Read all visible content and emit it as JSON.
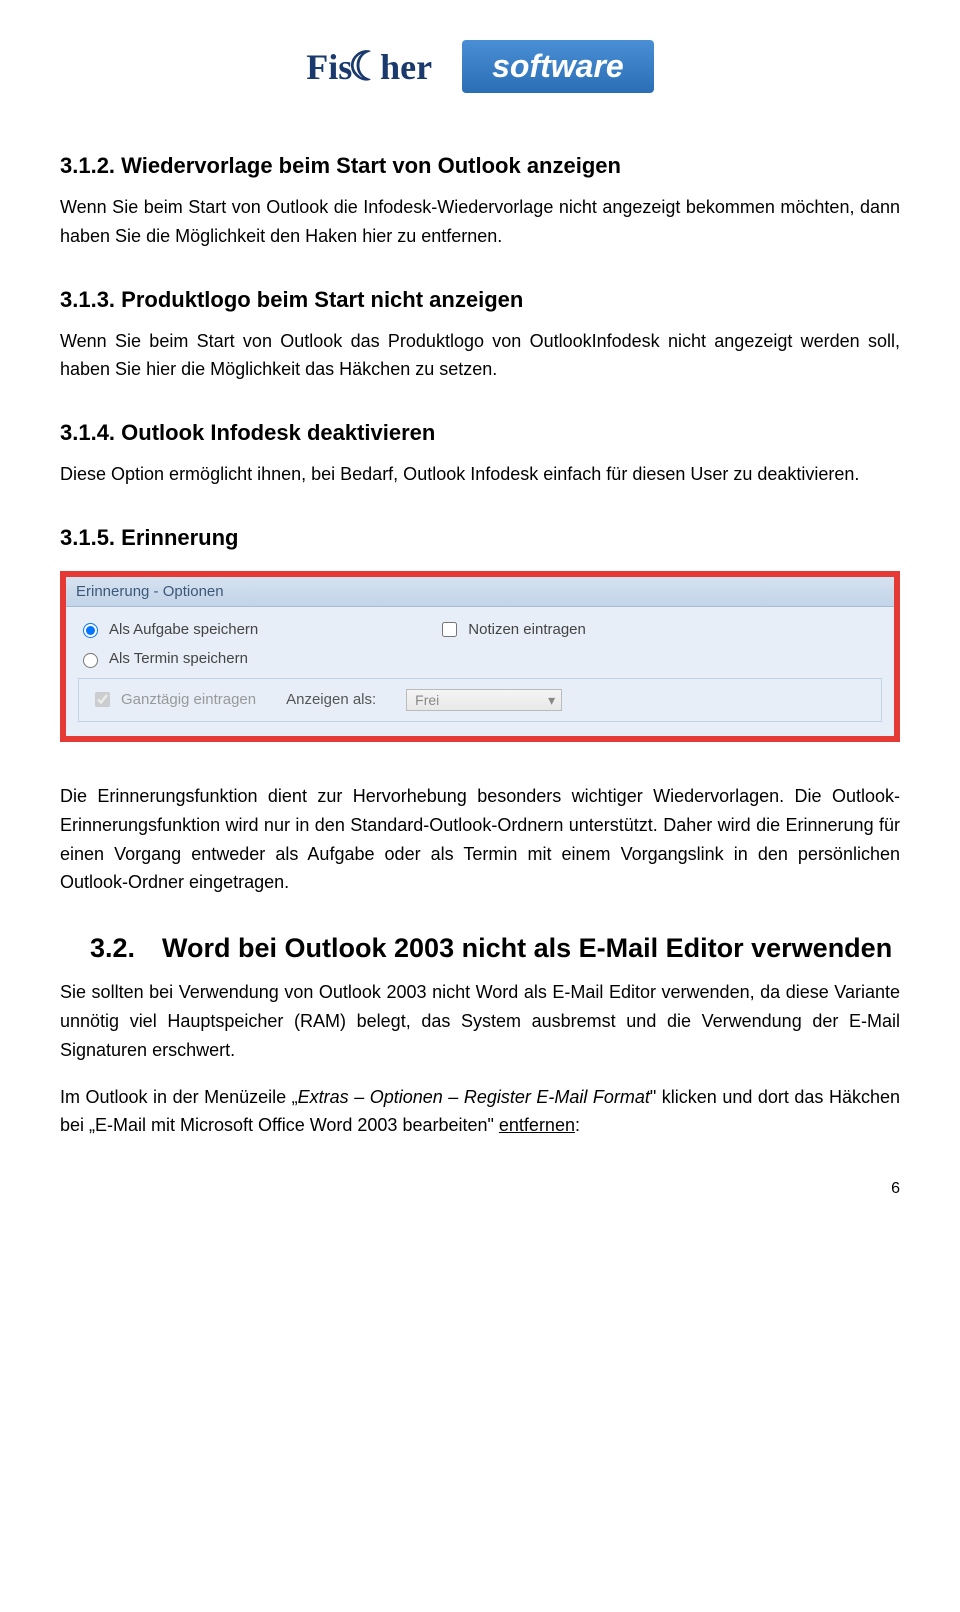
{
  "header": {
    "logo_left_1": "Fis",
    "logo_left_2": "her",
    "logo_right": "software"
  },
  "sections": {
    "s312": {
      "heading": "3.1.2. Wiedervorlage beim Start von Outlook anzeigen",
      "body": "Wenn Sie beim Start von Outlook die Infodesk-Wiedervorlage nicht angezeigt bekommen möchten, dann haben Sie die Möglichkeit den Haken hier zu entfernen."
    },
    "s313": {
      "heading": "3.1.3. Produktlogo beim Start nicht anzeigen",
      "body": "Wenn Sie beim Start von Outlook das Produktlogo von OutlookInfodesk nicht angezeigt werden soll, haben Sie hier die Möglichkeit das Häkchen zu setzen."
    },
    "s314": {
      "heading": "3.1.4. Outlook Infodesk deaktivieren",
      "body": "Diese Option ermöglicht ihnen, bei Bedarf, Outlook Infodesk einfach für diesen User zu deaktivieren."
    },
    "s315": {
      "heading": "3.1.5. Erinnerung",
      "body1": "Die Erinnerungsfunktion dient zur Hervorhebung besonders wichtiger Wiedervorlagen. Die Outlook-Erinnerungsfunktion wird nur in den Standard-Outlook-Ordnern unterstützt. Daher wird die Erinnerung für einen Vorgang entweder als Aufgabe oder als Termin mit einem Vorgangslink in den persönlichen Outlook-Ordner eingetragen."
    },
    "s32": {
      "heading": "3.2. Word bei Outlook 2003 nicht als E-Mail Editor verwenden",
      "body1": "Sie sollten bei Verwendung von Outlook 2003 nicht Word als E-Mail Editor verwenden, da diese Variante unnötig viel Hauptspeicher (RAM) belegt, das System ausbremst und die Verwendung der E-Mail Signaturen erschwert.",
      "body2_pre": "Im Outlook in der Menüzeile „",
      "body2_italic": "Extras – Optionen – Register E-Mail Format",
      "body2_mid": "\" klicken und dort das Häkchen bei „E-Mail mit Microsoft Office Word 2003 bearbeiten\" ",
      "body2_underline": "entfernen",
      "body2_end": ":"
    }
  },
  "panel": {
    "title": "Erinnerung - Optionen",
    "radio_aufgabe": "Als Aufgabe speichern",
    "radio_termin": "Als Termin speichern",
    "check_notizen": "Notizen eintragen",
    "check_ganztag": "Ganztägig eintragen",
    "anzeigen_label": "Anzeigen als:",
    "anzeigen_value": "Frei"
  },
  "page_number": "6"
}
